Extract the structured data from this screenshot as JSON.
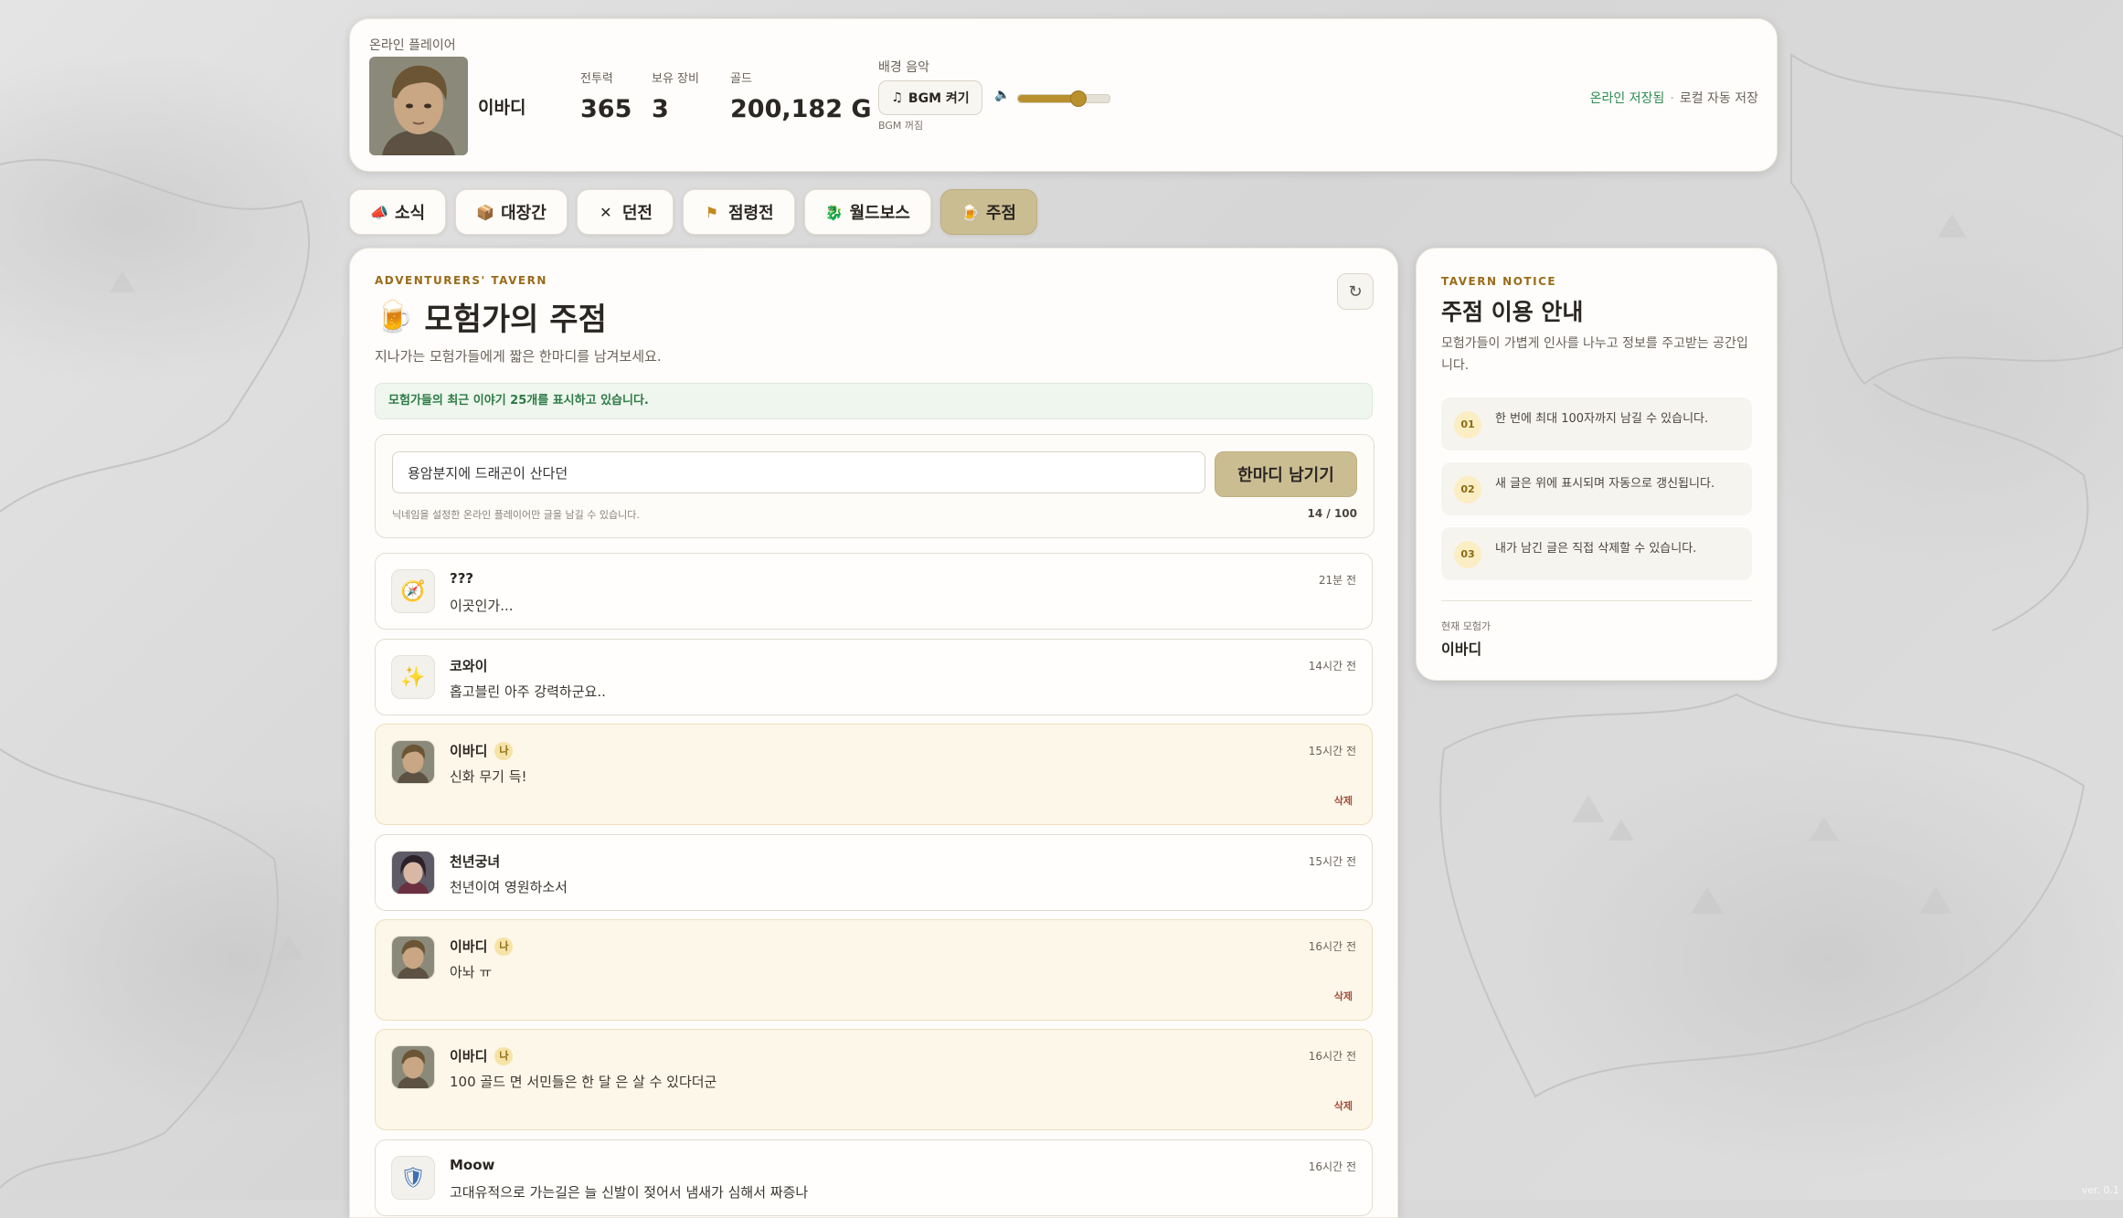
{
  "player": {
    "online_label": "온라인 플레이어",
    "name": "이바디",
    "stats": [
      {
        "label": "전투력",
        "value": "365"
      },
      {
        "label": "보유 장비",
        "value": "3"
      },
      {
        "label": "골드",
        "value": "200,182 G"
      }
    ],
    "bgm": {
      "label": "배경 음악",
      "button": "BGM 켜기",
      "status": "BGM 꺼짐",
      "volume_fraction": 0.65
    },
    "save": {
      "online": "온라인 저장됨",
      "sep": "·",
      "local": "로컬 자동 저장"
    }
  },
  "tabs": [
    {
      "label": "소식",
      "icon": "megaphone-icon",
      "glyph": "📣"
    },
    {
      "label": "대장간",
      "icon": "box-icon",
      "glyph": "📦"
    },
    {
      "label": "던전",
      "icon": "crossed-swords-icon",
      "glyph": "✕"
    },
    {
      "label": "점령전",
      "icon": "flag-icon",
      "glyph": "⚑"
    },
    {
      "label": "월드보스",
      "icon": "dragon-icon",
      "glyph": "🐉"
    },
    {
      "label": "주점",
      "icon": "beer-icon",
      "glyph": "🍺",
      "active": true
    }
  ],
  "tavern": {
    "eyebrow": "ADVENTURERS' TAVERN",
    "title": "모험가의 주점",
    "subtitle": "지나가는 모험가들에게 짧은 한마디를 남겨보세요.",
    "notice": "모험가들의 최근 이야기 25개를 표시하고 있습니다.",
    "compose": {
      "value": "용암분지에 드래곤이 산다던",
      "button": "한마디 남기기",
      "hint": "닉네임을 설정한 온라인 플레이어만 글을 남길 수 있습니다.",
      "count": "14 / 100"
    },
    "posts": [
      {
        "author": "???",
        "time": "21분 전",
        "text": "이곳인가...",
        "avatar": "compass-icon",
        "glyph": "🧭",
        "mine": false
      },
      {
        "author": "코와이",
        "time": "14시간 전",
        "text": "홉고블린 아주 강력하군요..",
        "avatar": "sparkle-icon",
        "glyph": "✨",
        "mine": false
      },
      {
        "author": "이바디",
        "time": "15시간 전",
        "text": "신화 무기 득!",
        "avatar": "portrait",
        "mine": true,
        "me": "나",
        "delete": "삭제"
      },
      {
        "author": "천년궁녀",
        "time": "15시간 전",
        "text": "천년이여 영원하소서",
        "avatar": "portrait-dark",
        "mine": false
      },
      {
        "author": "이바디",
        "time": "16시간 전",
        "text": "아놔 ㅠ",
        "avatar": "portrait",
        "mine": true,
        "me": "나",
        "delete": "삭제"
      },
      {
        "author": "이바디",
        "time": "16시간 전",
        "text": "100 골드 면 서민들은 한 달 은 살 수 있다더군",
        "avatar": "portrait",
        "mine": true,
        "me": "나",
        "delete": "삭제"
      },
      {
        "author": "Moow",
        "time": "16시간 전",
        "text": "고대유적으로 가는길은 늘 신발이 젖어서 냄새가 심해서 짜증나",
        "avatar": "shield-icon",
        "glyph": "🛡",
        "mine": false
      }
    ]
  },
  "side": {
    "eyebrow": "TAVERN NOTICE",
    "title": "주점 이용 안내",
    "desc": "모험가들이 가볍게 인사를 나누고 정보를 주고받는 공간입니다.",
    "rules": [
      {
        "num": "01",
        "text": "한 번에 최대 100자까지 남길 수 있습니다."
      },
      {
        "num": "02",
        "text": "새 글은 위에 표시되며 자동으로 갱신됩니다."
      },
      {
        "num": "03",
        "text": "내가 남긴 글은 직접 삭제할 수 있습니다."
      }
    ],
    "current_label": "현재 모험가",
    "current_name": "이바디"
  },
  "version": "ver. 0.1"
}
